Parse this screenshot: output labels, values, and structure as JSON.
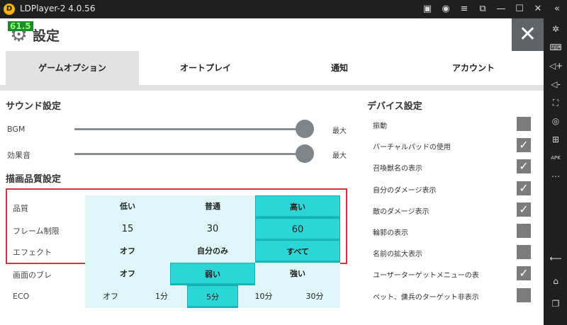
{
  "window": {
    "title": "LDPlayer-2 4.0.56",
    "logo_glyph": "D"
  },
  "titlebar_icons": [
    "gamepad-icon",
    "user-icon",
    "menu-icon",
    "screen-icon",
    "minimize-icon",
    "maximize-icon",
    "close-icon",
    "collapse-icon"
  ],
  "sidebar_icons": [
    "settings-icon",
    "keyboard-icon",
    "volume-up-icon",
    "volume-down-icon",
    "resize-icon",
    "record-icon",
    "add-icon",
    "apk-icon",
    "more-icon",
    "back-icon",
    "home-icon",
    "recent-apps-icon"
  ],
  "header": {
    "fps": "61.5",
    "title": "設定",
    "close_glyph": "✕"
  },
  "tabs": [
    {
      "label": "ゲームオプション",
      "active": true
    },
    {
      "label": "オートプレイ",
      "active": false
    },
    {
      "label": "通知",
      "active": false
    },
    {
      "label": "アカウント",
      "active": false
    }
  ],
  "sound": {
    "title": "サウンド設定",
    "bgm": {
      "label": "BGM",
      "max": "最大",
      "value": 1.0
    },
    "sfx": {
      "label": "効果音",
      "max": "最大",
      "value": 1.0
    }
  },
  "graphics": {
    "title": "描画品質設定",
    "rows": [
      {
        "label": "品質",
        "options": [
          "低い",
          "普通",
          "高い"
        ],
        "selected": 2
      },
      {
        "label": "フレーム制限",
        "options": [
          "15",
          "30",
          "60"
        ],
        "selected": 2
      },
      {
        "label": "エフェクト",
        "options": [
          "オフ",
          "自分のみ",
          "すべて"
        ],
        "selected": 2
      },
      {
        "label": "画面のブレ",
        "options": [
          "オフ",
          "弱い",
          "強い"
        ],
        "selected": 1
      },
      {
        "label": "ECO",
        "options": [
          "オフ",
          "1分",
          "5分",
          "10分",
          "30分"
        ],
        "selected": 2
      }
    ]
  },
  "device": {
    "title": "デバイス設定",
    "items": [
      {
        "label": "振動",
        "checked": false
      },
      {
        "label": "バーチャルパッドの使用",
        "checked": true
      },
      {
        "label": "召喚獣名の表示",
        "checked": true
      },
      {
        "label": "自分のダメージ表示",
        "checked": true
      },
      {
        "label": "敵のダメージ表示",
        "checked": true
      },
      {
        "label": "輪郭の表示",
        "checked": false
      },
      {
        "label": "名前の拡大表示",
        "checked": false
      },
      {
        "label": "ユーザーターゲットメニューの表",
        "checked": true
      },
      {
        "label": "ペット、傭兵のターゲット非表示",
        "checked": false
      }
    ],
    "check_glyph": "✓"
  },
  "colors": {
    "selected": "#2bd6d6",
    "option_bg": "#dff6f8",
    "highlight": "#d9323a"
  }
}
